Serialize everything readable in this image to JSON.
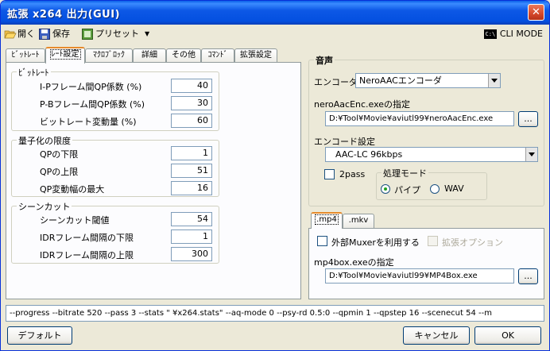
{
  "window": {
    "title": "拡張 x264 出力(GUI)"
  },
  "toolbar": {
    "open": "開く",
    "save": "保存",
    "preset": "プリセット",
    "cli_mode": "CLI MODE",
    "cli_icon": "C:\\"
  },
  "tabs": [
    "ﾋﾞｯﾄﾚｰﾄ",
    "ﾚｰﾄ設定",
    "ﾏｸﾛﾌﾞﾛｯｸ",
    "詳細",
    "その他",
    "ｺﾏﾝﾄﾞ",
    "拡張設定"
  ],
  "bitrate": {
    "title": "ﾋﾞｯﾄﾚｰﾄ",
    "ip_label": "I-Pフレーム間QP係数 (%)",
    "ip_value": "40",
    "pb_label": "P-Bフレーム間QP係数 (%)",
    "pb_value": "30",
    "var_label": "ビットレート変動量 (%)",
    "var_value": "60"
  },
  "quant": {
    "title": "量子化の限度",
    "min_label": "QPの下限",
    "min_value": "1",
    "max_label": "QPの上限",
    "max_value": "51",
    "step_label": "QP変動幅の最大",
    "step_value": "16"
  },
  "scenecut": {
    "title": "シーンカット",
    "thr_label": "シーンカット閾値",
    "thr_value": "54",
    "idrmin_label": "IDRフレーム間隔の下限",
    "idrmin_value": "1",
    "idrmax_label": "IDRフレーム間隔の上限",
    "idrmax_value": "300"
  },
  "audio": {
    "title": "音声",
    "encoder_label": "エンコーダ",
    "encoder_value": "NeroAACエンコーダ",
    "exe_label": "neroAacEnc.exeの指定",
    "exe_path": "D:¥Tool¥Movie¥aviutl99¥neroAacEnc.exe",
    "browse": "...",
    "setting_label": "エンコード設定",
    "setting_value": "AAC-LC 96kbps",
    "twopass": "2pass",
    "mode_title": "処理モード",
    "mode_pipe": "パイプ",
    "mode_wav": "WAV"
  },
  "mux": {
    "tabs": [
      ".mp4",
      ".mkv"
    ],
    "external_muxer": "外部Muxerを利用する",
    "ext_option": "拡張オプション",
    "mp4box_label": "mp4box.exeの指定",
    "mp4box_path": "D:¥Tool¥Movie¥aviutl99¥MP4Box.exe",
    "browse": "..."
  },
  "cmdline": "--progress --bitrate 520 --pass 3 --stats \" ¥x264.stats\" --aq-mode 0 --psy-rd 0.5:0 --qpmin 1 --qpstep 16 --scenecut 54 --m",
  "buttons": {
    "default": "デフォルト",
    "cancel": "キャンセル",
    "ok": "OK"
  }
}
